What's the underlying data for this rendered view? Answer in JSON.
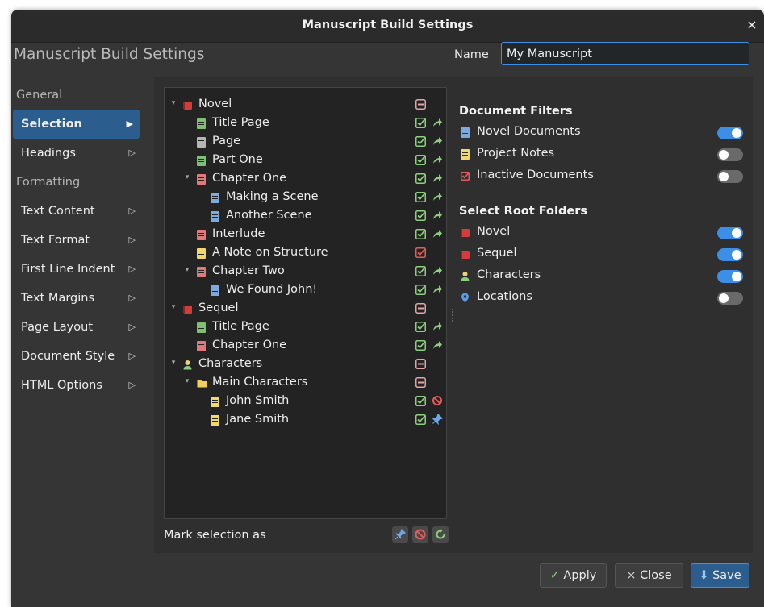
{
  "window": {
    "title": "Manuscript Build Settings",
    "close_glyph": "×"
  },
  "heading": "Manuscript Build Settings",
  "name_field": {
    "label": "Name",
    "value": "My Manuscript"
  },
  "nav": {
    "general_header": "General",
    "formatting_header": "Formatting",
    "items": [
      {
        "label": "Selection"
      },
      {
        "label": "Headings"
      },
      {
        "label": "Text Content"
      },
      {
        "label": "Text Format"
      },
      {
        "label": "First Line Indent"
      },
      {
        "label": "Text Margins"
      },
      {
        "label": "Page Layout"
      },
      {
        "label": "Document Style"
      },
      {
        "label": "HTML Options"
      }
    ]
  },
  "tree": {
    "rows": [
      {
        "label": "Novel",
        "icon": "novel-folder-icon",
        "state": "partial"
      },
      {
        "label": "Title Page",
        "icon": "document-green-icon",
        "state": "included"
      },
      {
        "label": "Page",
        "icon": "document-grey-icon",
        "state": "included"
      },
      {
        "label": "Part One",
        "icon": "document-green-icon",
        "state": "included"
      },
      {
        "label": "Chapter One",
        "icon": "document-red-icon",
        "state": "included"
      },
      {
        "label": "Making a Scene",
        "icon": "document-blue-icon",
        "state": "included"
      },
      {
        "label": "Another Scene",
        "icon": "document-blue-icon",
        "state": "included"
      },
      {
        "label": "Interlude",
        "icon": "document-red-icon",
        "state": "included"
      },
      {
        "label": "A Note on Structure",
        "icon": "note-yellow-icon",
        "state": "excluded"
      },
      {
        "label": "Chapter Two",
        "icon": "document-red-icon",
        "state": "included"
      },
      {
        "label": "We Found John!",
        "icon": "document-blue-icon",
        "state": "included"
      },
      {
        "label": "Sequel",
        "icon": "novel-folder-icon",
        "state": "partial"
      },
      {
        "label": "Title Page",
        "icon": "document-green-icon",
        "state": "included"
      },
      {
        "label": "Chapter One",
        "icon": "document-red-icon",
        "state": "included"
      },
      {
        "label": "Characters",
        "icon": "person-icon",
        "state": "partial"
      },
      {
        "label": "Main Characters",
        "icon": "folder-yellow-icon",
        "state": "partial"
      },
      {
        "label": "John Smith",
        "icon": "note-yellow-icon",
        "state": "blocked"
      },
      {
        "label": "Jane Smith",
        "icon": "note-yellow-icon",
        "state": "pinned"
      }
    ]
  },
  "mark_selection_label": "Mark selection as",
  "document_filters": {
    "title": "Document Filters",
    "items": [
      {
        "label": "Novel Documents",
        "on": true
      },
      {
        "label": "Project Notes",
        "on": false
      },
      {
        "label": "Inactive Documents",
        "on": false
      }
    ]
  },
  "root_folders": {
    "title": "Select Root Folders",
    "items": [
      {
        "label": "Novel",
        "on": true
      },
      {
        "label": "Sequel",
        "on": true
      },
      {
        "label": "Characters",
        "on": true
      },
      {
        "label": "Locations",
        "on": false
      }
    ]
  },
  "buttons": {
    "apply": "Apply",
    "close": "Close",
    "save": "Save"
  },
  "colors": {
    "accent": "#3d8ee6",
    "selection": "#2c5d8f",
    "included": "#8ccf7e",
    "excluded": "#e25c5c"
  }
}
